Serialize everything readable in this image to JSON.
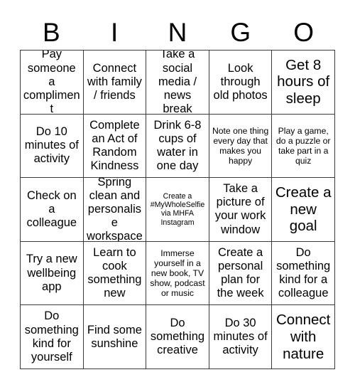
{
  "card": {
    "title": "BINGO",
    "header_letters": [
      "B",
      "I",
      "N",
      "G",
      "O"
    ],
    "columns": 5,
    "rows": 5,
    "border_color": "#3a3a3a",
    "text_color": "#000000",
    "background_color": "#ffffff",
    "cells": [
      {
        "text": "Pay someone a compliment",
        "size": "md"
      },
      {
        "text": "Connect with family / friends",
        "size": "md"
      },
      {
        "text": "Take a social media / news break",
        "size": "md"
      },
      {
        "text": "Look through old photos",
        "size": "md"
      },
      {
        "text": "Get 8 hours of sleep",
        "size": "lg"
      },
      {
        "text": "Do 10 minutes of activity",
        "size": "md"
      },
      {
        "text": "Complete an Act of Random Kindness",
        "size": "md"
      },
      {
        "text": "Drink 6-8 cups of water in one day",
        "size": "md"
      },
      {
        "text": "Note one thing every day that makes you happy",
        "size": "sm"
      },
      {
        "text": "Play a game, do a puzzle or take part in a quiz",
        "size": "sm"
      },
      {
        "text": "Check on a colleague",
        "size": "md"
      },
      {
        "text": "Spring clean and personalise workspace",
        "size": "md"
      },
      {
        "text": "Create a #MyWholeSelfie via MHFA Instagram",
        "size": "xs"
      },
      {
        "text": "Take a picture of your work window",
        "size": "md"
      },
      {
        "text": "Create a new goal",
        "size": "lg"
      },
      {
        "text": "Try a new wellbeing app",
        "size": "md"
      },
      {
        "text": "Learn to cook something new",
        "size": "md"
      },
      {
        "text": "Immerse yourself in a new book, TV show, podcast or music",
        "size": "sm"
      },
      {
        "text": "Create a personal plan for the week",
        "size": "md"
      },
      {
        "text": "Do something kind for a colleague",
        "size": "md"
      },
      {
        "text": "Do something kind for yourself",
        "size": "md"
      },
      {
        "text": "Find some sunshine",
        "size": "md"
      },
      {
        "text": "Do something creative",
        "size": "md"
      },
      {
        "text": "Do 30 minutes of activity",
        "size": "md"
      },
      {
        "text": "Connect with nature",
        "size": "lg"
      }
    ]
  }
}
